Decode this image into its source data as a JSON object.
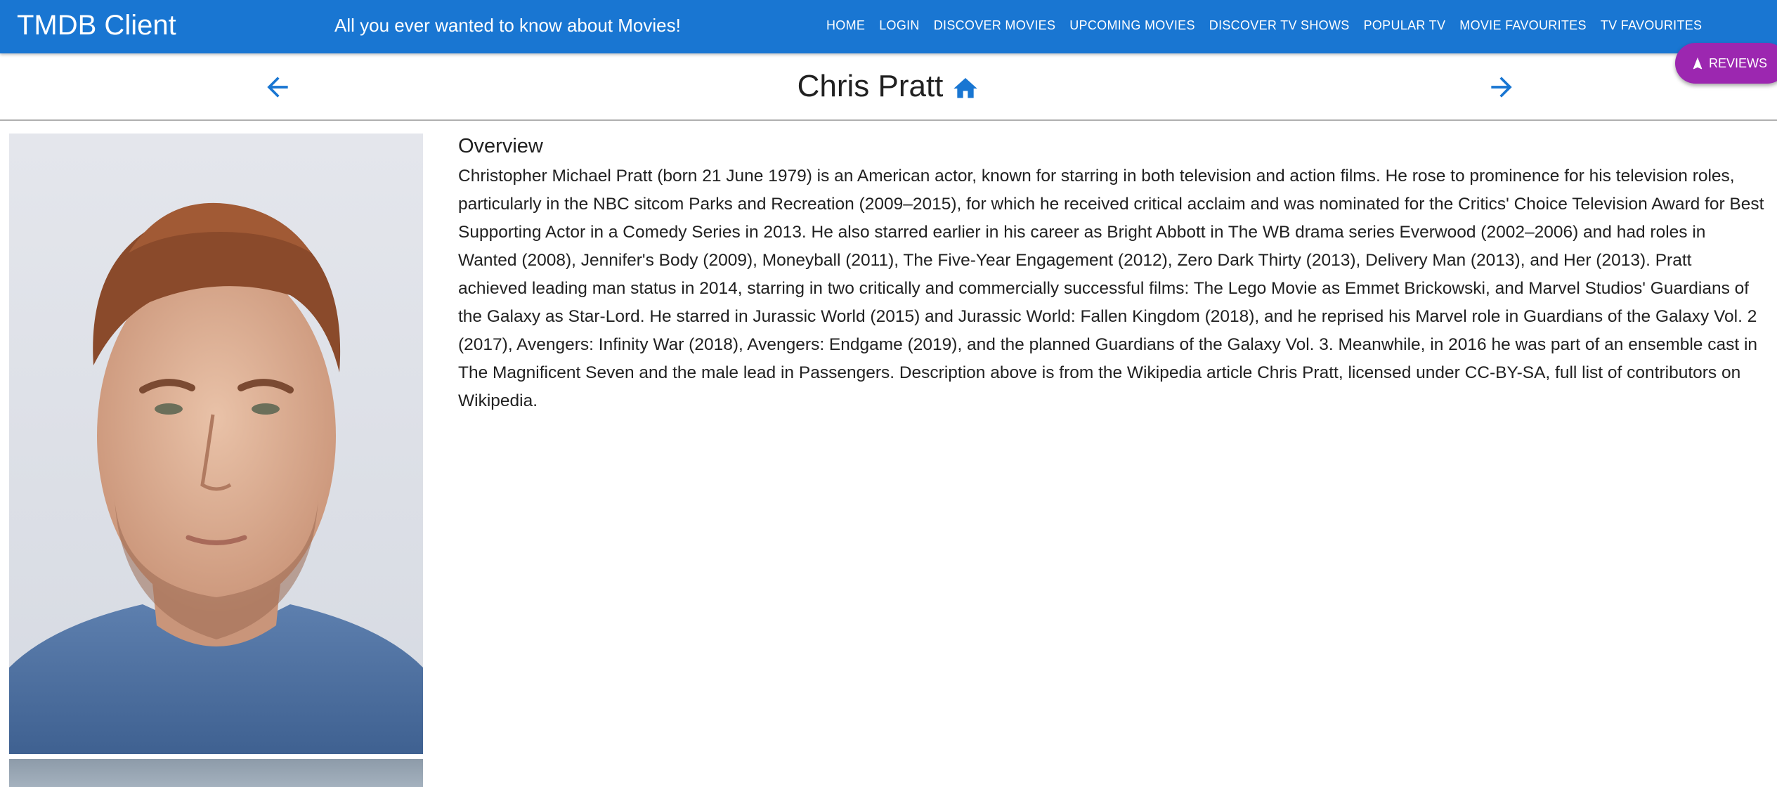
{
  "appbar": {
    "brand": "TMDB Client",
    "tagline": "All you ever wanted to know about Movies!",
    "nav_items": [
      "HOME",
      "LOGIN",
      "DISCOVER MOVIES",
      "UPCOMING MOVIES",
      "DISCOVER TV SHOWS",
      "POPULAR TV",
      "MOVIE FAVOURITES",
      "TV FAVOURITES"
    ],
    "color": "#1976d2"
  },
  "fab": {
    "label": "REVIEWS",
    "icon": "navigation-icon",
    "color": "#9c27b0"
  },
  "header": {
    "title": "Chris Pratt",
    "back_icon": "arrow-back-icon",
    "forward_icon": "arrow-forward-icon",
    "home_icon": "home-icon"
  },
  "overview": {
    "heading": "Overview",
    "text": "Christopher Michael Pratt (born 21 June 1979) is an American actor, known for starring in both television and action films. He rose to prominence for his television roles, particularly in the NBC sitcom Parks and Recreation (2009–2015), for which he received critical acclaim and was nominated for the Critics' Choice Television Award for Best Supporting Actor in a Comedy Series in 2013. He also starred earlier in his career as Bright Abbott in The WB drama series Everwood (2002–2006) and had roles in Wanted (2008), Jennifer's Body (2009), Moneyball (2011), The Five-Year Engagement (2012), Zero Dark Thirty (2013), Delivery Man (2013), and Her (2013). Pratt achieved leading man status in 2014, starring in two critically and commercially successful films: The Lego Movie as Emmet Brickowski, and Marvel Studios' Guardians of the Galaxy as Star-Lord. He starred in Jurassic World (2015) and Jurassic World: Fallen Kingdom (2018), and he reprised his Marvel role in Guardians of the Galaxy Vol. 2 (2017), Avengers: Infinity War (2018), Avengers: Endgame (2019), and the planned Guardians of the Galaxy Vol. 3. Meanwhile, in 2016 he was part of an ensemble cast in The Magnificent Seven and the male lead in Passengers. Description above is from the Wikipedia article Chris Pratt, licensed under CC-BY-SA, full list of contributors on Wikipedia."
  }
}
